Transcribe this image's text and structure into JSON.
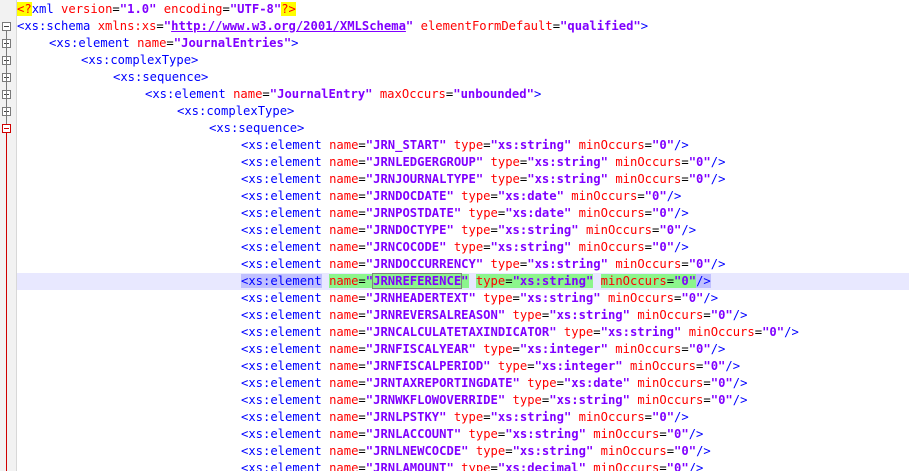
{
  "editor": {
    "lines": [
      {
        "indent": 0,
        "fold": "",
        "tokens": [
          {
            "t": "decl",
            "v": "<?"
          },
          {
            "t": "declname",
            "v": "xml"
          },
          {
            "t": "txt",
            "v": " "
          },
          {
            "t": "attr",
            "v": "version"
          },
          {
            "t": "txt",
            "v": "="
          },
          {
            "t": "str",
            "v": "\"1.0\""
          },
          {
            "t": "txt",
            "v": " "
          },
          {
            "t": "attr",
            "v": "encoding"
          },
          {
            "t": "txt",
            "v": "="
          },
          {
            "t": "str",
            "v": "\"UTF-8\""
          },
          {
            "t": "decl",
            "v": "?>"
          }
        ]
      },
      {
        "indent": 0,
        "fold": "open",
        "tokens": [
          {
            "t": "tag",
            "v": "<xs:schema"
          },
          {
            "t": "txt",
            "v": " "
          },
          {
            "t": "attr",
            "v": "xmlns:xs"
          },
          {
            "t": "txt",
            "v": "="
          },
          {
            "t": "str",
            "v": "\""
          },
          {
            "t": "url",
            "v": "http://www.w3.org/2001/XMLSchema"
          },
          {
            "t": "str",
            "v": "\""
          },
          {
            "t": "txt",
            "v": " "
          },
          {
            "t": "attr",
            "v": "elementFormDefault"
          },
          {
            "t": "txt",
            "v": "="
          },
          {
            "t": "str",
            "v": "\"qualified\""
          },
          {
            "t": "tag",
            "v": ">"
          }
        ]
      },
      {
        "indent": 1,
        "fold": "open",
        "tokens": [
          {
            "t": "tag",
            "v": "<xs:element"
          },
          {
            "t": "txt",
            "v": " "
          },
          {
            "t": "attr",
            "v": "name"
          },
          {
            "t": "txt",
            "v": "="
          },
          {
            "t": "str",
            "v": "\"JournalEntries\""
          },
          {
            "t": "tag",
            "v": ">"
          }
        ]
      },
      {
        "indent": 2,
        "fold": "open",
        "tokens": [
          {
            "t": "tag",
            "v": "<xs:complexType>"
          }
        ]
      },
      {
        "indent": 3,
        "fold": "open",
        "tokens": [
          {
            "t": "tag",
            "v": "<xs:sequence>"
          }
        ]
      },
      {
        "indent": 4,
        "fold": "open",
        "tokens": [
          {
            "t": "tag",
            "v": "<xs:element"
          },
          {
            "t": "txt",
            "v": " "
          },
          {
            "t": "attr",
            "v": "name"
          },
          {
            "t": "txt",
            "v": "="
          },
          {
            "t": "str",
            "v": "\"JournalEntry\""
          },
          {
            "t": "txt",
            "v": " "
          },
          {
            "t": "attr",
            "v": "maxOccurs"
          },
          {
            "t": "txt",
            "v": "="
          },
          {
            "t": "str",
            "v": "\"unbounded\""
          },
          {
            "t": "tag",
            "v": ">"
          }
        ]
      },
      {
        "indent": 5,
        "fold": "open",
        "tokens": [
          {
            "t": "tag",
            "v": "<xs:complexType>"
          }
        ]
      },
      {
        "indent": 6,
        "fold": "red",
        "tokens": [
          {
            "t": "tag",
            "v": "<xs:sequence>"
          }
        ]
      },
      {
        "indent": 7,
        "fields": [
          "JRN_START",
          "xs:string",
          "0"
        ]
      },
      {
        "indent": 7,
        "fields": [
          "JRNLEDGERGROUP",
          "xs:string",
          "0"
        ]
      },
      {
        "indent": 7,
        "fields": [
          "JRNJOURNALTYPE",
          "xs:string",
          "0"
        ]
      },
      {
        "indent": 7,
        "fields": [
          "JRNDOCDATE",
          "xs:date",
          "0"
        ]
      },
      {
        "indent": 7,
        "fields": [
          "JRNPOSTDATE",
          "xs:date",
          "0"
        ]
      },
      {
        "indent": 7,
        "fields": [
          "JRNDOCTYPE",
          "xs:string",
          "0"
        ]
      },
      {
        "indent": 7,
        "fields": [
          "JRNCOCODE",
          "xs:string",
          "0"
        ]
      },
      {
        "indent": 7,
        "fields": [
          "JRNDOCCURRENCY",
          "xs:string",
          "0"
        ]
      },
      {
        "indent": 7,
        "fields": [
          "JRNREFERENCE",
          "xs:string",
          "0"
        ],
        "highlight": true
      },
      {
        "indent": 7,
        "fields": [
          "JRNHEADERTEXT",
          "xs:string",
          "0"
        ]
      },
      {
        "indent": 7,
        "fields": [
          "JRNREVERSALREASON",
          "xs:string",
          "0"
        ]
      },
      {
        "indent": 7,
        "fields": [
          "JRNCALCULATETAXINDICATOR",
          "xs:string",
          "0"
        ]
      },
      {
        "indent": 7,
        "fields": [
          "JRNFISCALYEAR",
          "xs:integer",
          "0"
        ]
      },
      {
        "indent": 7,
        "fields": [
          "JRNFISCALPERIOD",
          "xs:integer",
          "0"
        ]
      },
      {
        "indent": 7,
        "fields": [
          "JRNTAXREPORTINGDATE",
          "xs:date",
          "0"
        ]
      },
      {
        "indent": 7,
        "fields": [
          "JRNWKFLOWOVERRIDE",
          "xs:string",
          "0"
        ]
      },
      {
        "indent": 7,
        "fields": [
          "JRNLPSTKY",
          "xs:string",
          "0"
        ]
      },
      {
        "indent": 7,
        "fields": [
          "JRNLACCOUNT",
          "xs:string",
          "0"
        ]
      },
      {
        "indent": 7,
        "fields": [
          "JRNLNEWCOCDE",
          "xs:string",
          "0"
        ]
      },
      {
        "indent": 7,
        "fields": [
          "JRNLAMOUNT",
          "xs:decimal",
          "0"
        ]
      }
    ]
  },
  "colors": {
    "tag": "#0000ff",
    "attr": "#ff0000",
    "value": "#8000ff",
    "highlight_line": "#e8e8ff",
    "match_highlight": "#8cf58c",
    "decl_bg": "#ffff00"
  }
}
